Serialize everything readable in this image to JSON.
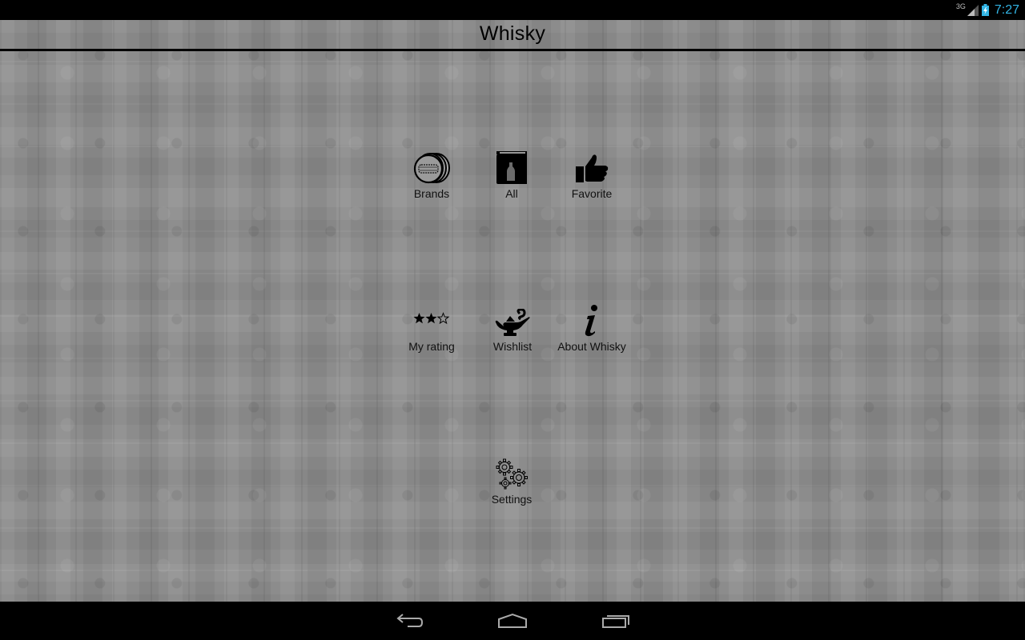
{
  "status_bar": {
    "network": "3G",
    "time": "7:27",
    "signal_icon": "signal-icon",
    "battery_icon": "battery-charging-icon"
  },
  "action_bar": {
    "title": "Whisky"
  },
  "menu": [
    {
      "label": "Brands",
      "icon": "barrel-icon"
    },
    {
      "label": "All",
      "icon": "book-bottle-icon"
    },
    {
      "label": "Favorite",
      "icon": "thumbs-up-icon"
    },
    {
      "label": "My rating",
      "icon": "stars-rating-icon",
      "rating": 2,
      "rating_max": 3
    },
    {
      "label": "Wishlist",
      "icon": "genie-lamp-icon"
    },
    {
      "label": "About Whisky",
      "icon": "info-icon"
    },
    {
      "label": "Settings",
      "icon": "gears-icon"
    }
  ],
  "nav_bar": {
    "back": "back-icon",
    "home": "home-icon",
    "recents": "recents-icon"
  },
  "colors": {
    "clock": "#33b5e5",
    "background": "#8c8c8c"
  }
}
